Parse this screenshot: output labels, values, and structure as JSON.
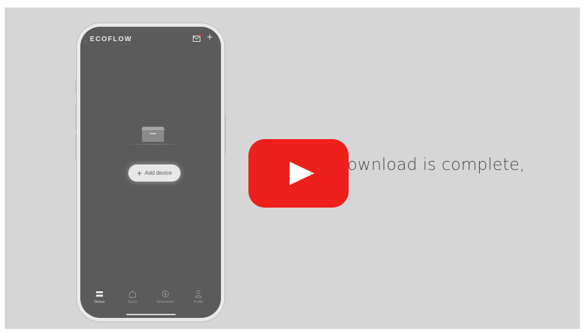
{
  "app": {
    "brand": "ECOFLOW",
    "add_device_label": "Add device"
  },
  "nav": [
    {
      "label": "Device",
      "icon": "device-icon"
    },
    {
      "label": "Space",
      "icon": "home-icon"
    },
    {
      "label": "Automation",
      "icon": "automation-icon"
    },
    {
      "label": "Profile",
      "icon": "profile-icon"
    }
  ],
  "video": {
    "subtitle": "ownload is complete,",
    "player_accent": "#ee1f1d"
  },
  "colors": {
    "background": "#d6d6d6",
    "screen": "#5b5b5b"
  }
}
